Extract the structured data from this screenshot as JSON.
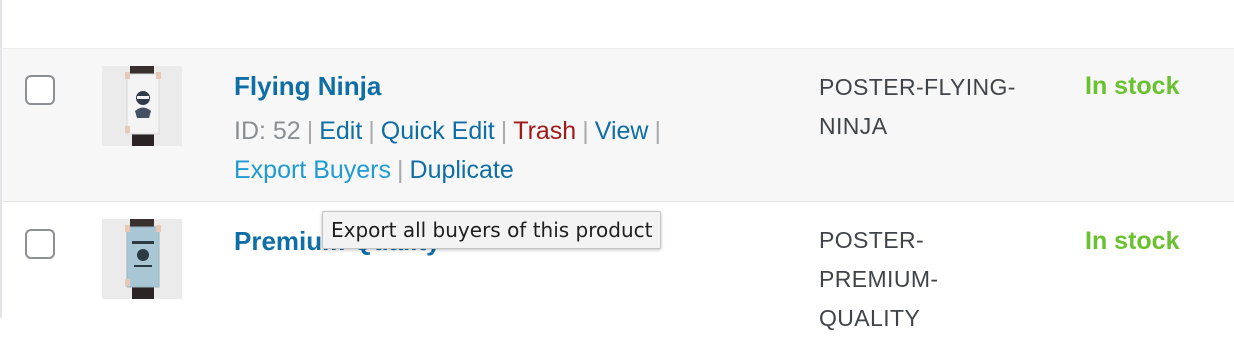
{
  "products": [
    {
      "name": "Flying Ninja",
      "id_label": "ID: 52",
      "actions": {
        "edit": "Edit",
        "quick_edit": "Quick Edit",
        "trash": "Trash",
        "view": "View",
        "export_buyers": "Export Buyers",
        "duplicate": "Duplicate"
      },
      "sku_line1": "POSTER-FLYING-",
      "sku_line2": "NINJA",
      "stock": "In stock",
      "thumbnail": "ninja-poster-thumbnail"
    },
    {
      "name": "Premium Quality",
      "sku_line1": "POSTER-",
      "sku_line2": "PREMIUM-",
      "sku_line3": "QUALITY",
      "stock": "In stock",
      "thumbnail": "premium-quality-poster-thumbnail"
    }
  ],
  "tooltip": {
    "text": "Export all buyers of this product"
  },
  "colors": {
    "link": "#0f6ea5",
    "trash": "#a11a1a",
    "hover_link": "#1f9ad3",
    "in_stock": "#69c12f",
    "row_highlight": "#f7f7f7"
  }
}
